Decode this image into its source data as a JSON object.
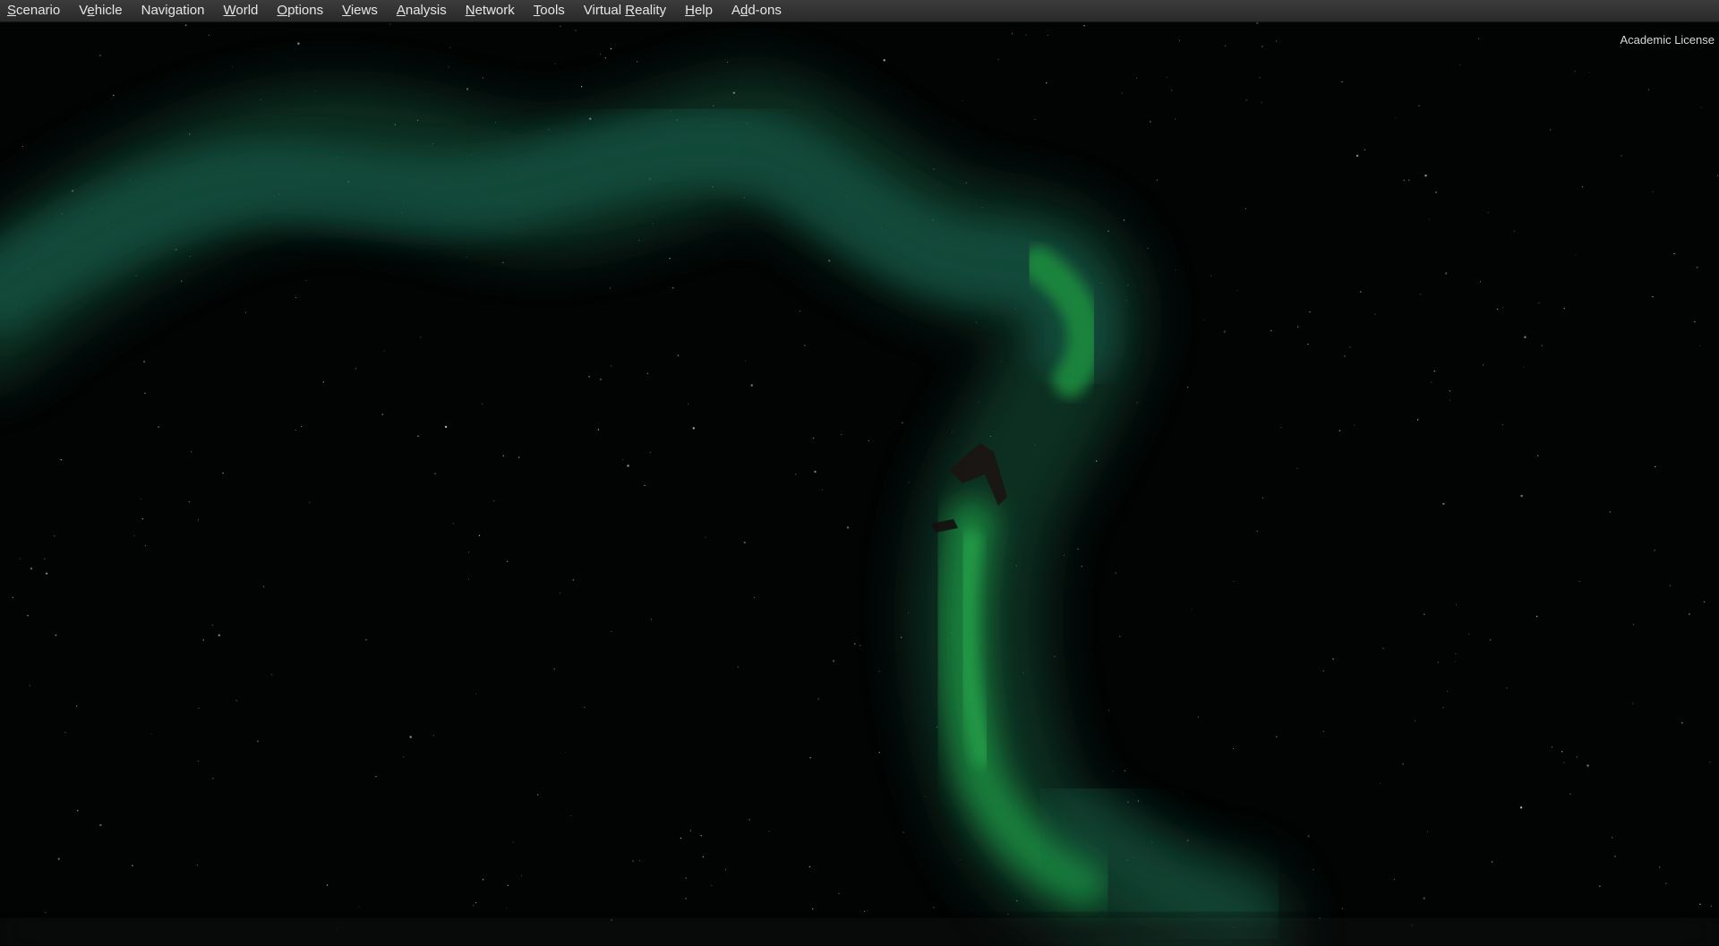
{
  "menubar": {
    "items": [
      {
        "pre": "",
        "key": "S",
        "post": "cenario"
      },
      {
        "pre": "V",
        "key": "e",
        "post": "hicle"
      },
      {
        "pre": "Navi",
        "key": "g",
        "post": "ation"
      },
      {
        "pre": "",
        "key": "W",
        "post": "orld"
      },
      {
        "pre": "",
        "key": "O",
        "post": "ptions"
      },
      {
        "pre": "",
        "key": "V",
        "post": "iews"
      },
      {
        "pre": "",
        "key": "A",
        "post": "nalysis"
      },
      {
        "pre": "",
        "key": "N",
        "post": "etwork"
      },
      {
        "pre": "",
        "key": "T",
        "post": "ools"
      },
      {
        "pre": "Virtual ",
        "key": "R",
        "post": "eality"
      },
      {
        "pre": "",
        "key": "H",
        "post": "elp"
      },
      {
        "pre": "A",
        "key": "d",
        "post": "d-ons"
      }
    ]
  },
  "viewport": {
    "license_label": "Academic License",
    "sky_color": "#020404",
    "aurora_color": "#1f9a4a",
    "aurora_teal": "#167c6c"
  }
}
